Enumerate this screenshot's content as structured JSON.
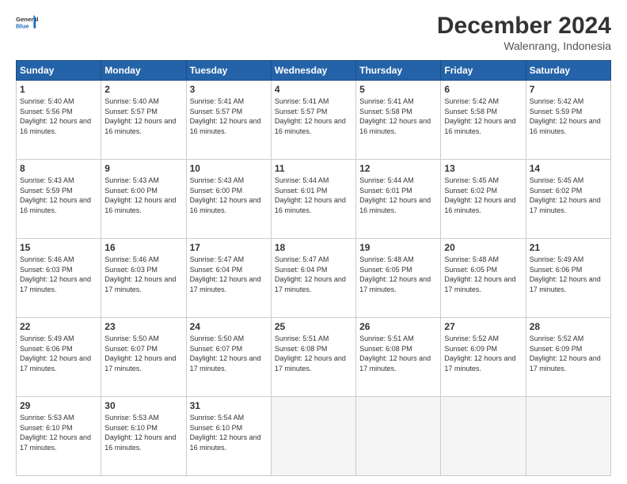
{
  "logo": {
    "general": "General",
    "blue": "Blue"
  },
  "header": {
    "month": "December 2024",
    "location": "Walenrang, Indonesia"
  },
  "days_of_week": [
    "Sunday",
    "Monday",
    "Tuesday",
    "Wednesday",
    "Thursday",
    "Friday",
    "Saturday"
  ],
  "weeks": [
    [
      {
        "day": "1",
        "sunrise": "5:40 AM",
        "sunset": "5:56 PM",
        "daylight": "12 hours and 16 minutes."
      },
      {
        "day": "2",
        "sunrise": "5:40 AM",
        "sunset": "5:57 PM",
        "daylight": "12 hours and 16 minutes."
      },
      {
        "day": "3",
        "sunrise": "5:41 AM",
        "sunset": "5:57 PM",
        "daylight": "12 hours and 16 minutes."
      },
      {
        "day": "4",
        "sunrise": "5:41 AM",
        "sunset": "5:57 PM",
        "daylight": "12 hours and 16 minutes."
      },
      {
        "day": "5",
        "sunrise": "5:41 AM",
        "sunset": "5:58 PM",
        "daylight": "12 hours and 16 minutes."
      },
      {
        "day": "6",
        "sunrise": "5:42 AM",
        "sunset": "5:58 PM",
        "daylight": "12 hours and 16 minutes."
      },
      {
        "day": "7",
        "sunrise": "5:42 AM",
        "sunset": "5:59 PM",
        "daylight": "12 hours and 16 minutes."
      }
    ],
    [
      {
        "day": "8",
        "sunrise": "5:43 AM",
        "sunset": "5:59 PM",
        "daylight": "12 hours and 16 minutes."
      },
      {
        "day": "9",
        "sunrise": "5:43 AM",
        "sunset": "6:00 PM",
        "daylight": "12 hours and 16 minutes."
      },
      {
        "day": "10",
        "sunrise": "5:43 AM",
        "sunset": "6:00 PM",
        "daylight": "12 hours and 16 minutes."
      },
      {
        "day": "11",
        "sunrise": "5:44 AM",
        "sunset": "6:01 PM",
        "daylight": "12 hours and 16 minutes."
      },
      {
        "day": "12",
        "sunrise": "5:44 AM",
        "sunset": "6:01 PM",
        "daylight": "12 hours and 16 minutes."
      },
      {
        "day": "13",
        "sunrise": "5:45 AM",
        "sunset": "6:02 PM",
        "daylight": "12 hours and 16 minutes."
      },
      {
        "day": "14",
        "sunrise": "5:45 AM",
        "sunset": "6:02 PM",
        "daylight": "12 hours and 17 minutes."
      }
    ],
    [
      {
        "day": "15",
        "sunrise": "5:46 AM",
        "sunset": "6:03 PM",
        "daylight": "12 hours and 17 minutes."
      },
      {
        "day": "16",
        "sunrise": "5:46 AM",
        "sunset": "6:03 PM",
        "daylight": "12 hours and 17 minutes."
      },
      {
        "day": "17",
        "sunrise": "5:47 AM",
        "sunset": "6:04 PM",
        "daylight": "12 hours and 17 minutes."
      },
      {
        "day": "18",
        "sunrise": "5:47 AM",
        "sunset": "6:04 PM",
        "daylight": "12 hours and 17 minutes."
      },
      {
        "day": "19",
        "sunrise": "5:48 AM",
        "sunset": "6:05 PM",
        "daylight": "12 hours and 17 minutes."
      },
      {
        "day": "20",
        "sunrise": "5:48 AM",
        "sunset": "6:05 PM",
        "daylight": "12 hours and 17 minutes."
      },
      {
        "day": "21",
        "sunrise": "5:49 AM",
        "sunset": "6:06 PM",
        "daylight": "12 hours and 17 minutes."
      }
    ],
    [
      {
        "day": "22",
        "sunrise": "5:49 AM",
        "sunset": "6:06 PM",
        "daylight": "12 hours and 17 minutes."
      },
      {
        "day": "23",
        "sunrise": "5:50 AM",
        "sunset": "6:07 PM",
        "daylight": "12 hours and 17 minutes."
      },
      {
        "day": "24",
        "sunrise": "5:50 AM",
        "sunset": "6:07 PM",
        "daylight": "12 hours and 17 minutes."
      },
      {
        "day": "25",
        "sunrise": "5:51 AM",
        "sunset": "6:08 PM",
        "daylight": "12 hours and 17 minutes."
      },
      {
        "day": "26",
        "sunrise": "5:51 AM",
        "sunset": "6:08 PM",
        "daylight": "12 hours and 17 minutes."
      },
      {
        "day": "27",
        "sunrise": "5:52 AM",
        "sunset": "6:09 PM",
        "daylight": "12 hours and 17 minutes."
      },
      {
        "day": "28",
        "sunrise": "5:52 AM",
        "sunset": "6:09 PM",
        "daylight": "12 hours and 17 minutes."
      }
    ],
    [
      {
        "day": "29",
        "sunrise": "5:53 AM",
        "sunset": "6:10 PM",
        "daylight": "12 hours and 17 minutes."
      },
      {
        "day": "30",
        "sunrise": "5:53 AM",
        "sunset": "6:10 PM",
        "daylight": "12 hours and 16 minutes."
      },
      {
        "day": "31",
        "sunrise": "5:54 AM",
        "sunset": "6:10 PM",
        "daylight": "12 hours and 16 minutes."
      },
      null,
      null,
      null,
      null
    ]
  ],
  "labels": {
    "sunrise": "Sunrise:",
    "sunset": "Sunset:",
    "daylight": "Daylight:"
  }
}
